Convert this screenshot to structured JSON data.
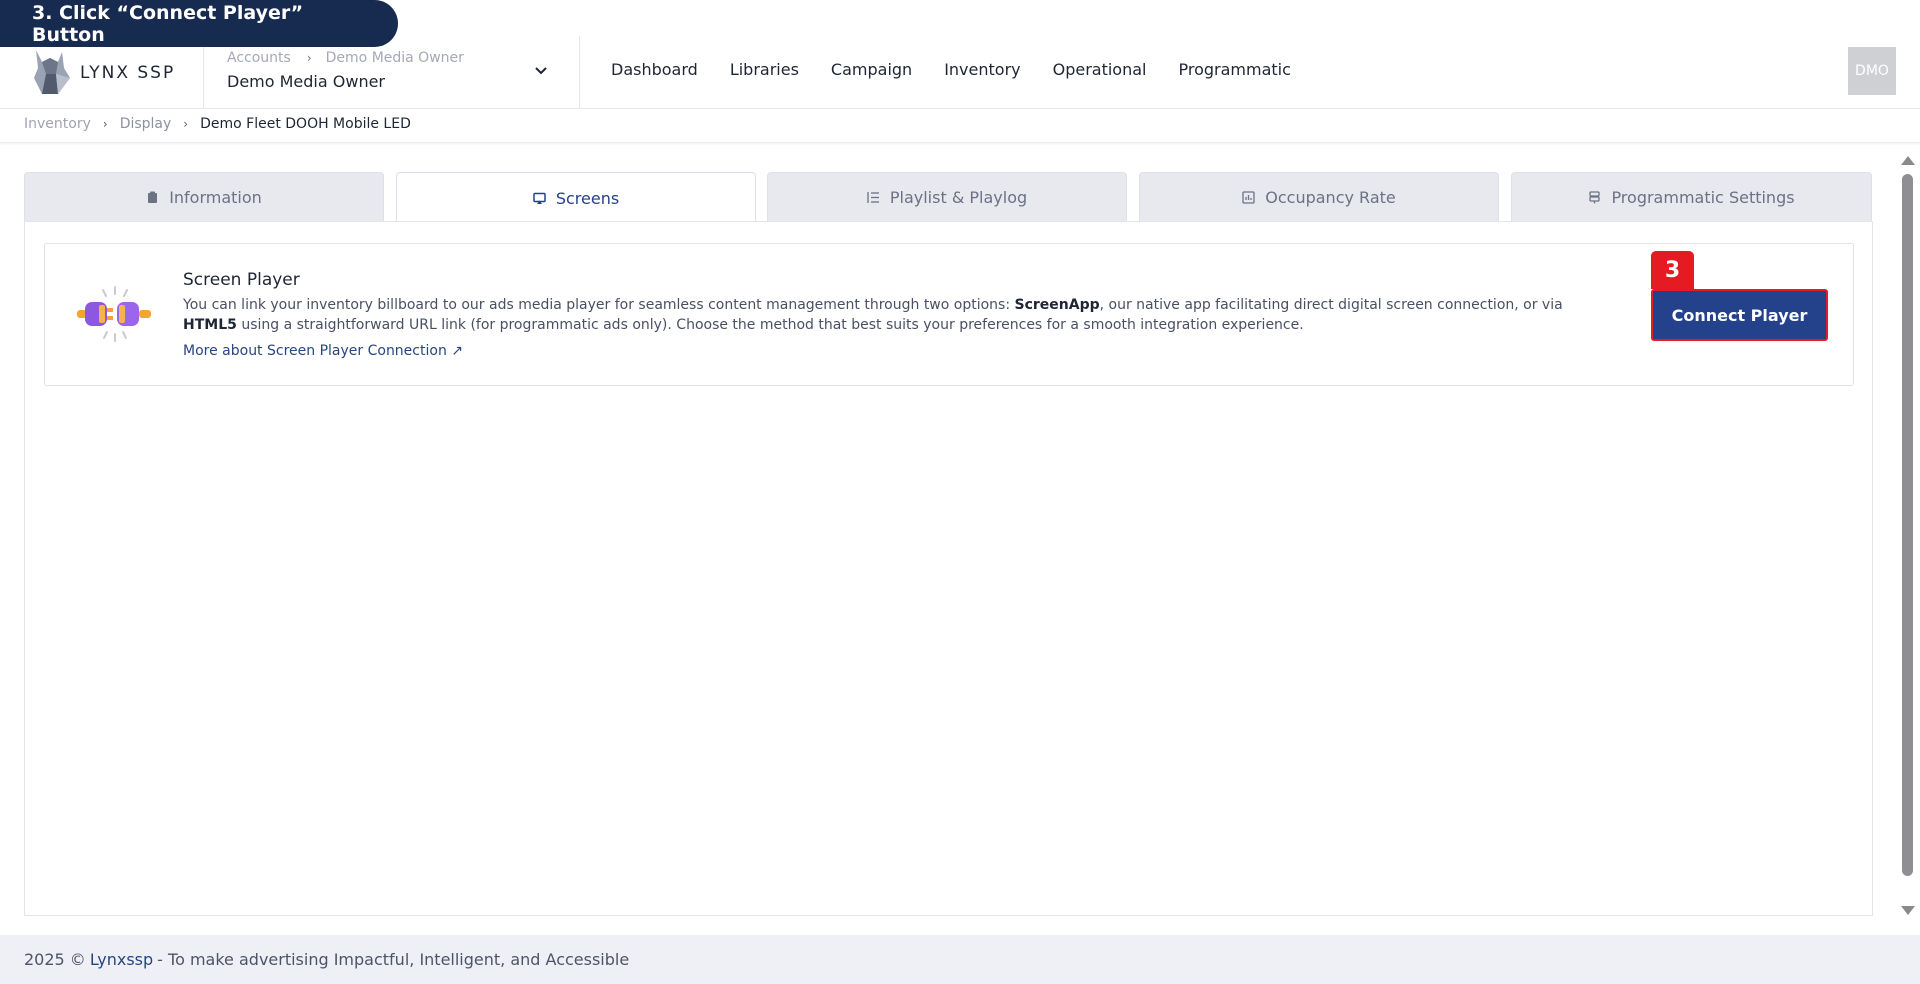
{
  "callout": {
    "text": "3. Click “Connect Player” Button"
  },
  "header": {
    "logo_text": "LYNX SSP",
    "account": {
      "crumb_root": "Accounts",
      "crumb_child": "Demo Media Owner",
      "name": "Demo Media Owner"
    },
    "nav": [
      "Dashboard",
      "Libraries",
      "Campaign",
      "Inventory",
      "Operational",
      "Programmatic"
    ],
    "user_initials": "DMO"
  },
  "breadcrumb": [
    "Inventory",
    "Display",
    "Demo Fleet DOOH Mobile LED"
  ],
  "tabs": [
    {
      "label": "Information",
      "icon": "clipboard-icon"
    },
    {
      "label": "Screens",
      "icon": "cast-icon"
    },
    {
      "label": "Playlist & Playlog",
      "icon": "list-icon"
    },
    {
      "label": "Occupancy Rate",
      "icon": "chart-icon"
    },
    {
      "label": "Programmatic Settings",
      "icon": "server-icon"
    }
  ],
  "active_tab": "Screens",
  "card": {
    "title": "Screen Player",
    "desc_1": "You can link your inventory billboard to our ads media player for seamless content management through two options: ",
    "desc_bold_1": "ScreenApp",
    "desc_2": ", our native app facilitating direct digital screen connection, or via ",
    "desc_bold_2": "HTML5",
    "desc_3": " using a straightforward URL link (for programmatic ads only). Choose the method that best suits your preferences for a smooth integration experience.",
    "link": "More about Screen Player Connection ↗",
    "button": "Connect Player",
    "step_badge": "3"
  },
  "footer": {
    "prefix": "2025 ©",
    "brand": "Lynxssp",
    "suffix": "- To make advertising Impactful, Intelligent, and Accessible"
  },
  "colors": {
    "primary": "#24418c",
    "highlight": "#e51b23",
    "callout_bg": "#172a4f"
  }
}
